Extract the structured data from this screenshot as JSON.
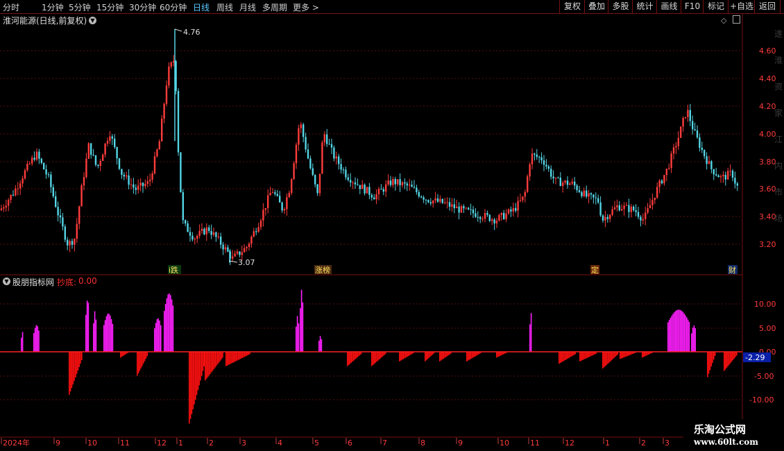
{
  "toolbar": {
    "periods": [
      "分时",
      "1分钟",
      "5分钟",
      "15分钟",
      "30分钟",
      "60分钟",
      "日线",
      "周线",
      "月线",
      "多周期",
      "更多 >"
    ],
    "active_period": "日线",
    "buttons": [
      "复权",
      "叠加",
      "多股",
      "统计",
      "画线",
      "F10",
      "标记",
      "+自选",
      "返回"
    ]
  },
  "main_chart": {
    "title": "淮河能源(日线,前复权)",
    "y_ticks": [
      "4.60",
      "4.40",
      "4.20",
      "4.00",
      "3.80",
      "3.60",
      "3.40",
      "3.20"
    ],
    "high_label": "4.76",
    "low_label": "3.07",
    "event_tags": [
      "i跌",
      "涨榜",
      "定",
      "财"
    ],
    "colors": {
      "up": "#ff3c3c",
      "down": "#54d6e6"
    },
    "right_side_glyphs": "遂淮资家江内市场"
  },
  "indicator": {
    "title": "股朋指标网",
    "name": "抄底:",
    "value": "0.00",
    "y_ticks": [
      "10.00",
      "5.00",
      "0.00",
      "-5.00",
      "-10.00"
    ],
    "current_value": "-2.29",
    "colors": {
      "positive": "#ff20ff",
      "negative": "#ff1010",
      "zero_line": "#ff2020"
    }
  },
  "time_axis": {
    "labels": [
      "2024年",
      "9",
      "10",
      "11",
      "12",
      "1",
      "2",
      "3",
      "4",
      "5",
      "6",
      "7",
      "8",
      "9",
      "10",
      "11",
      "12",
      "1",
      "2",
      "3"
    ]
  },
  "watermark": {
    "line1": "乐淘公式网",
    "line2": "www.60lt.com"
  }
}
